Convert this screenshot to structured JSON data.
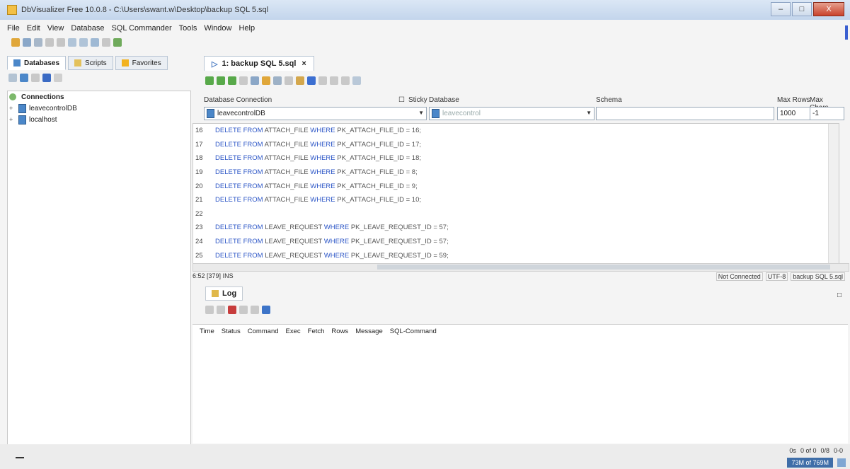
{
  "window": {
    "title": "DbVisualizer Free 10.0.8 - C:\\Users\\swant.w\\Desktop\\backup SQL 5.sql",
    "controls": [
      "–",
      "□",
      "X"
    ]
  },
  "menu": [
    "File",
    "Edit",
    "View",
    "Database",
    "SQL Commander",
    "Tools",
    "Window",
    "Help"
  ],
  "left_tabs": [
    {
      "label": "Databases"
    },
    {
      "label": "Scripts"
    },
    {
      "label": "Favorites"
    }
  ],
  "tree": {
    "root": "Connections",
    "items": [
      "leavecontrolDB",
      "localhost"
    ]
  },
  "editor_tab": {
    "label": "1: backup SQL 5.sql",
    "close": "×"
  },
  "connection_labels": {
    "database_connection": "Database Connection",
    "sticky": "Sticky",
    "database": "Database",
    "schema": "Schema",
    "max_rows": "Max Rows",
    "max_chars": "Max Chars"
  },
  "connection_values": {
    "connection": "leavecontrolDB",
    "database": "leavecontrol",
    "schema": "",
    "max_rows": "1000",
    "max_chars": "-1"
  },
  "code_lines": [
    {
      "num": "16",
      "kw1": "DELETE FROM",
      "t1": " ATTACH_FILE ",
      "kw2": "WHERE",
      "t2": " PK_ATTACH_FILE_ID = 16;"
    },
    {
      "num": "17",
      "kw1": "DELETE FROM",
      "t1": " ATTACH_FILE ",
      "kw2": "WHERE",
      "t2": " PK_ATTACH_FILE_ID = 17;"
    },
    {
      "num": "18",
      "kw1": "DELETE FROM",
      "t1": " ATTACH_FILE ",
      "kw2": "WHERE",
      "t2": " PK_ATTACH_FILE_ID = 18;"
    },
    {
      "num": "19",
      "kw1": "DELETE FROM",
      "t1": " ATTACH_FILE ",
      "kw2": "WHERE",
      "t2": " PK_ATTACH_FILE_ID = 8;"
    },
    {
      "num": "20",
      "kw1": "DELETE FROM",
      "t1": " ATTACH_FILE ",
      "kw2": "WHERE",
      "t2": " PK_ATTACH_FILE_ID = 9;"
    },
    {
      "num": "21",
      "kw1": "DELETE FROM",
      "t1": " ATTACH_FILE ",
      "kw2": "WHERE",
      "t2": " PK_ATTACH_FILE_ID = 10;"
    },
    {
      "num": "22",
      "kw1": "",
      "t1": "",
      "kw2": "",
      "t2": ""
    },
    {
      "num": "23",
      "kw1": "DELETE FROM",
      "t1": " LEAVE_REQUEST ",
      "kw2": "WHERE",
      "t2": " PK_LEAVE_REQUEST_ID = 57;"
    },
    {
      "num": "24",
      "kw1": "DELETE FROM",
      "t1": " LEAVE_REQUEST ",
      "kw2": "WHERE",
      "t2": " PK_LEAVE_REQUEST_ID = 57;"
    },
    {
      "num": "25",
      "kw1": "DELETE FROM",
      "t1": " LEAVE_REQUEST ",
      "kw2": "WHERE",
      "t2": " PK_LEAVE_REQUEST_ID = 59;"
    }
  ],
  "status": {
    "position": "6:52 [379]",
    "mode": "INS",
    "connection": "Not Connected",
    "encoding": "UTF-8",
    "file": "backup SQL 5.sql"
  },
  "log": {
    "tab_label": "Log",
    "headers": [
      "Time",
      "Status",
      "Command",
      "Exec",
      "Fetch",
      "Rows",
      "Message",
      "SQL-Command"
    ]
  },
  "bottom": {
    "time": "0s",
    "count": "0 of 0",
    "ratio": "0/8",
    "zero": "0-0",
    "memory": "73M of 769M"
  }
}
